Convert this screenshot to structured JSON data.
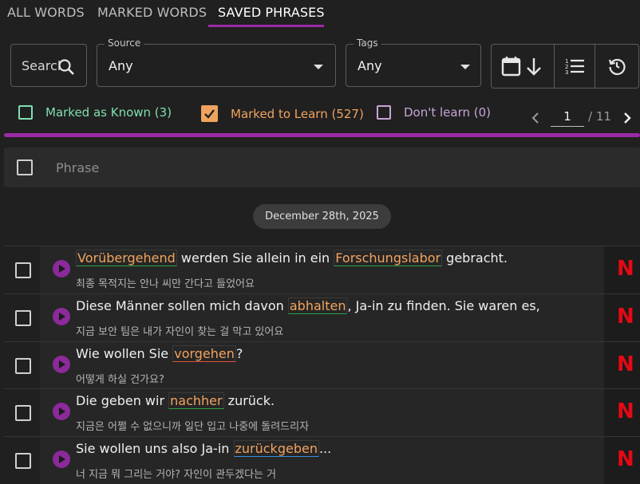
{
  "tabs": [
    {
      "label": "ALL WORDS",
      "active": false
    },
    {
      "label": "MARKED WORDS",
      "active": false
    },
    {
      "label": "SAVED PHRASES",
      "active": true
    }
  ],
  "search": {
    "placeholder": "Search"
  },
  "source": {
    "legend": "Source",
    "value": "Any"
  },
  "tags": {
    "legend": "Tags",
    "value": "Any"
  },
  "toolbar_icons": [
    "calendar-sort-icon",
    "numbered-list-icon",
    "history-icon"
  ],
  "filters": [
    {
      "label": "Marked as Known (3)",
      "checked": false,
      "color": "#7fe0b0"
    },
    {
      "label": "Marked to Learn (527)",
      "checked": true,
      "color": "#f0a35e"
    },
    {
      "label": "Don't learn (0)",
      "checked": false,
      "color": "#c9a5d6"
    }
  ],
  "pager": {
    "current": "1",
    "total": "/ 11"
  },
  "table": {
    "header": "Phrase"
  },
  "date_chip": "December 28th, 2025",
  "rows": [
    {
      "parts": [
        "",
        "Vorübergehend",
        " werden Sie allein in ein ",
        "Forschungslabor",
        " gebracht."
      ],
      "translation": "최종 목적지는 안나 씨만 간다고 들었어요"
    },
    {
      "parts": [
        "Diese Männer sollen mich davon ",
        "abhalten",
        ", Ja-in zu finden. Sie waren es,"
      ],
      "translation": "지금 보안 팀은 내가 자인이 찾는 걸 막고 있어요"
    },
    {
      "parts": [
        "Wie wollen Sie ",
        "vorgehen",
        "?"
      ],
      "translation": "어떻게 하실 건가요?"
    },
    {
      "parts": [
        "Die geben wir ",
        "nachher",
        " zurück."
      ],
      "translation": "지금은 어쩔 수 없으니까 일단 입고 나중에 돌려드리자"
    },
    {
      "parts": [
        "Sie wollen uns also Ja-in ",
        "zurückgeben",
        "..."
      ],
      "translation": "너 지금 뭐 그리는 거야? 자인이 관두겠다는 거"
    }
  ],
  "source_icon": "netflix-icon",
  "colors": {
    "accent": "#9b2aa7",
    "highlight_text": "#f2a35e",
    "netflix": "#e50914"
  }
}
